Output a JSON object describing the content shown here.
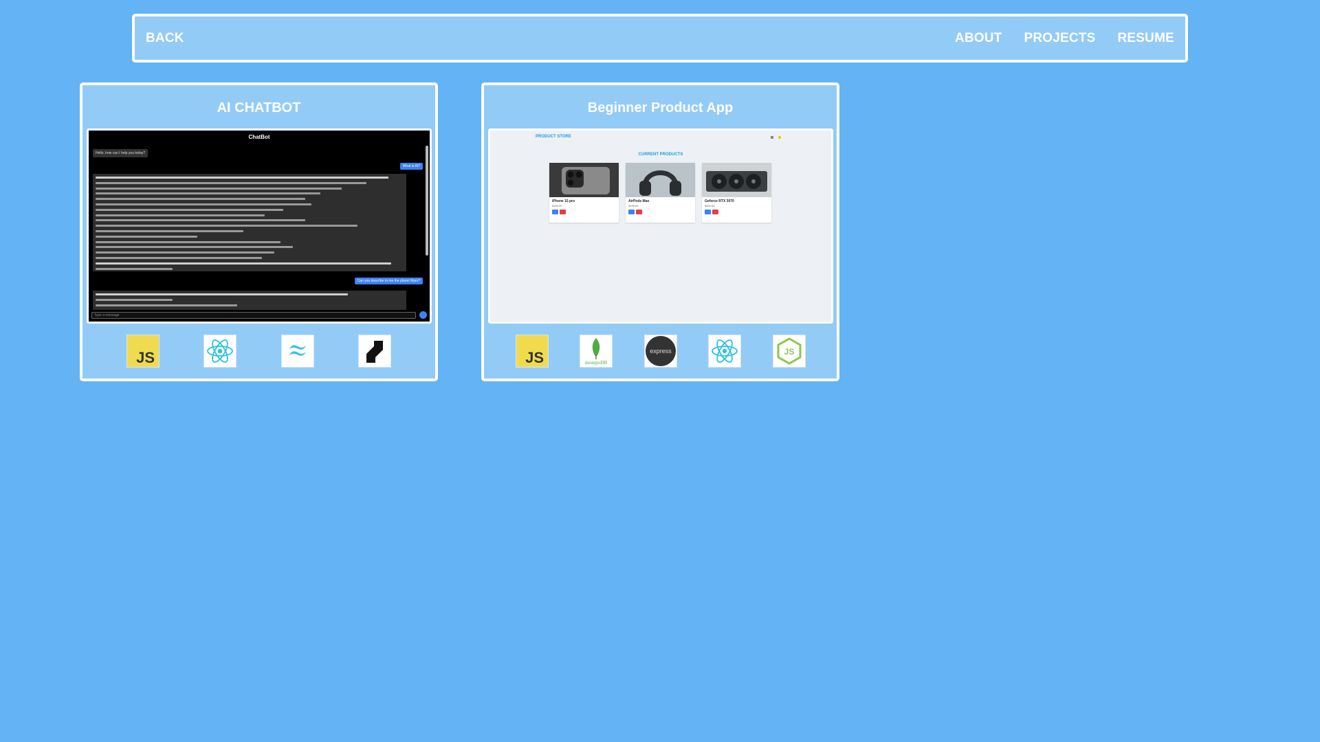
{
  "nav": {
    "back": "BACK",
    "links": [
      "ABOUT",
      "PROJECTS",
      "RESUME"
    ]
  },
  "projects": [
    {
      "title": "AI CHATBOT",
      "preview": {
        "header": "ChatBot",
        "greeting": "Hello, how can I help you today?",
        "user_message_1": "What is AI?",
        "user_message_2": "Can you describe to me the planet Mars?",
        "input_placeholder": "Type a message"
      },
      "tech_icons": [
        "javascript-icon",
        "react-icon",
        "tailwind-icon",
        "framer-motion-icon"
      ]
    },
    {
      "title": "Beginner Product App",
      "preview": {
        "brand": "PRODUCT STORE",
        "heading": "CURRENT PRODUCTS",
        "products": [
          {
            "name": "iPhone 15 pro",
            "price": "$199.99"
          },
          {
            "name": "AirPods Max",
            "price": "$199.99"
          },
          {
            "name": "Geforce RTX 3070",
            "price": "$499.99"
          }
        ]
      },
      "tech_icons": [
        "javascript-icon",
        "mongodb-icon",
        "express-icon",
        "react-icon",
        "nodejs-icon"
      ]
    }
  ],
  "colors": {
    "background": "#63b3f5",
    "panel": "#93cbf7",
    "border": "#ffffff"
  }
}
